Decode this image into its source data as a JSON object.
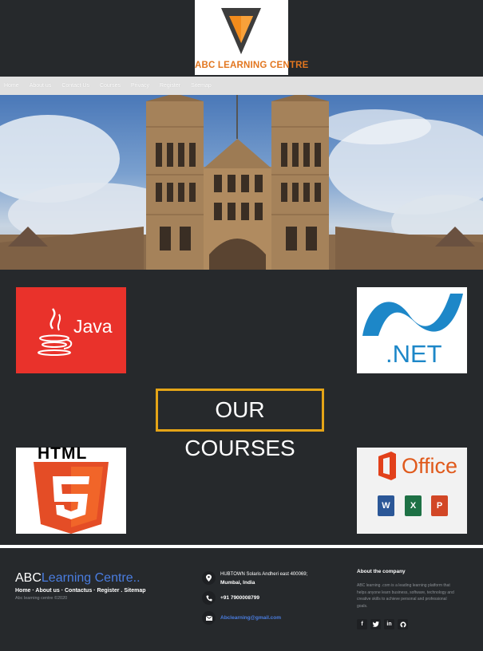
{
  "logo": {
    "text": "ABC LEARNING CENTRE",
    "accent": "#e2761f"
  },
  "nav": {
    "items": [
      "Home",
      "About us",
      "Contact Us",
      "Courses",
      "Privacy",
      "Register",
      "Sitemap"
    ]
  },
  "courses": {
    "title": "OUR COURSES",
    "tiles": {
      "java": "Java",
      "net": ".NET",
      "html": "HTML",
      "office": "Office"
    }
  },
  "footer": {
    "brand_a": "ABC",
    "brand_b": "Learning Centre..",
    "links": [
      "Home",
      "About us",
      "Contactus",
      "Register",
      "Sitemap"
    ],
    "copyright": "Abc learning centre ©2020",
    "address_line1": "HUBTOWN Solaris Andheri east 400069;",
    "address_line2": "Mumbai, India",
    "phone": "+91 7900008799",
    "email": "Abclearning@gmail.com",
    "about_title": "About the company",
    "about_text": "ABC learning .com is a leading learning platform that helps anyone learn business, software, technology and creative skills to achieve personal and professional goals.",
    "social": [
      "f",
      "t",
      "in",
      "gh"
    ]
  }
}
